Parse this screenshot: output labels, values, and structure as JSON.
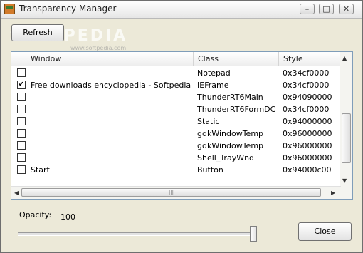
{
  "window": {
    "title": "Transparency Manager",
    "minimize_glyph": "–",
    "maximize_glyph": "□",
    "close_glyph": "✕"
  },
  "watermark": {
    "main": "SOFTPEDIA",
    "sub": "www.softpedia.com"
  },
  "toolbar": {
    "refresh_label": "Refresh"
  },
  "table": {
    "columns": [
      "Window",
      "Class",
      "Style"
    ],
    "rows": [
      {
        "checked": false,
        "window": "",
        "class": "Notepad",
        "style": "0x34cf0000"
      },
      {
        "checked": true,
        "window": "Free downloads encyclopedia - Softpedia - ...",
        "class": "IEFrame",
        "style": "0x34cf0000"
      },
      {
        "checked": false,
        "window": "",
        "class": "ThunderRT6Main",
        "style": "0x94090000"
      },
      {
        "checked": false,
        "window": "",
        "class": "ThunderRT6FormDC",
        "style": "0x34cf0000"
      },
      {
        "checked": false,
        "window": "",
        "class": "Static",
        "style": "0x94000000"
      },
      {
        "checked": false,
        "window": "",
        "class": "gdkWindowTemp",
        "style": "0x96000000"
      },
      {
        "checked": false,
        "window": "",
        "class": "gdkWindowTemp",
        "style": "0x96000000"
      },
      {
        "checked": false,
        "window": "",
        "class": "Shell_TrayWnd",
        "style": "0x96000000"
      },
      {
        "checked": false,
        "window": "Start",
        "class": "Button",
        "style": "0x94000c00"
      }
    ]
  },
  "opacity": {
    "label": "Opacity:",
    "value": "100",
    "slider_max": 100
  },
  "footer": {
    "close_label": "Close"
  },
  "glyphs": {
    "check": "✔",
    "up": "▲",
    "down": "▼",
    "left": "◀",
    "right": "▶",
    "grip": "|||"
  }
}
